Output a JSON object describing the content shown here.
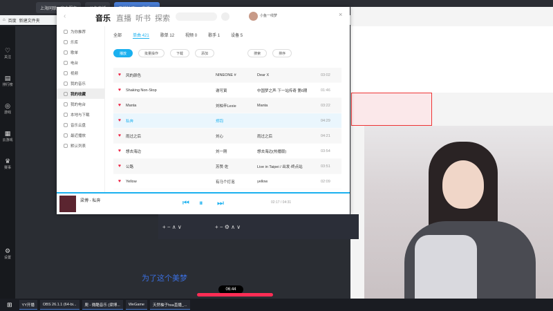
{
  "browser": {
    "tabs": [
      "上海同联 - 安全服务",
      "斗鱼直播",
      "天然柚子hsa直播_..."
    ],
    "bookmarks": [
      "百度",
      "新建文件夹"
    ]
  },
  "rail": [
    {
      "icon": "radio-icon",
      "label": "关注"
    },
    {
      "icon": "rank-icon",
      "label": "排行榜"
    },
    {
      "icon": "game-icon",
      "label": "游戏"
    },
    {
      "icon": "store-icon",
      "label": "云游戏"
    },
    {
      "icon": "trophy-icon",
      "label": "赛事"
    },
    {
      "icon": "settings-icon",
      "label": "设置"
    }
  ],
  "music": {
    "nav": [
      "音乐",
      "直播",
      "听书",
      "探索"
    ],
    "user": "小鱼一线梦",
    "tabs": [
      "全部",
      "单曲 421",
      "歌单 12",
      "视频 0",
      "歌手 1",
      "设备 5"
    ],
    "actions": [
      "播放",
      "批量操作",
      "下载",
      "添加",
      "搜索",
      "排序"
    ],
    "sidebar": [
      "为你推荐",
      "乐库",
      "歌单",
      "电台",
      "视频",
      "我的音乐",
      "我的收藏",
      "我的电台",
      "本地与下载",
      "音乐云盘",
      "最近播放",
      "默认列表"
    ],
    "songs": [
      {
        "title": "风的颜色",
        "artist": "NINEONE #",
        "album": "Dear X",
        "duration": "03:02"
      },
      {
        "title": "Shaking Non-Stop",
        "artist": "谢可寅",
        "album": "中国梦之声·下一站传奇 第6期",
        "duration": "01:46"
      },
      {
        "title": "Manta",
        "artist": "刘柏辛Lexie",
        "album": "Manta",
        "duration": "03:22"
      },
      {
        "title": "私奔",
        "artist": "郑钧",
        "album": "",
        "duration": "04:29"
      },
      {
        "title": "雨过之后",
        "artist": "刘心",
        "album": "雨过之后",
        "duration": "04:21"
      },
      {
        "title": "想去海边",
        "artist": "刘一刚",
        "album": "想去海边(热播版)",
        "duration": "03:54"
      },
      {
        "title": "公路",
        "artist": "苏赞·佐",
        "album": "Live in Taipei / 出发·终点站",
        "duration": "03:51"
      },
      {
        "title": "Yellow",
        "artist": "有马个灯泡",
        "album": "yellow",
        "duration": "02:09"
      }
    ],
    "now_playing": "梁博 - 私奔",
    "time": "02:17 / 04:31"
  },
  "overlay": {
    "subtitle": "为了这个美梦",
    "timer": "06:44"
  },
  "taskbar": [
    "YY开播",
    "OBS 26.1.1 (64-bi...",
    "爬 - 微酷音乐 (梁博...",
    "WeGame",
    "天然柚子hsa直播_..."
  ]
}
